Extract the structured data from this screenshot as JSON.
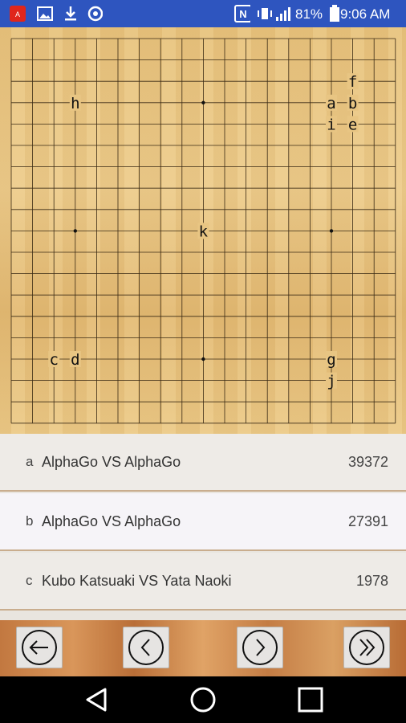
{
  "statusbar": {
    "left_icons": [
      "adobe-reader-icon",
      "image-icon",
      "download-icon",
      "sync-icon"
    ],
    "nfc_label": "N",
    "battery_percent": "81%",
    "time": "9:06 AM",
    "right_icons": [
      "nfc-icon",
      "vibrate-icon",
      "signal-icon",
      "battery-icon"
    ]
  },
  "board": {
    "size": 19,
    "labels": [
      {
        "text": "a"
      },
      {
        "text": "b"
      },
      {
        "text": "c"
      },
      {
        "text": "d"
      },
      {
        "text": "e"
      },
      {
        "text": "f"
      },
      {
        "text": "g"
      },
      {
        "text": "h"
      },
      {
        "text": "i"
      },
      {
        "text": "j"
      },
      {
        "text": "k"
      }
    ]
  },
  "games": [
    {
      "letter": "a",
      "title": "AlphaGo VS AlphaGo",
      "count": "39372"
    },
    {
      "letter": "b",
      "title": "AlphaGo VS AlphaGo",
      "count": "27391"
    },
    {
      "letter": "c",
      "title": "Kubo Katsuaki VS Yata Naoki",
      "count": "1978"
    }
  ],
  "controls": [
    {
      "name": "first-move-button",
      "icon": "arrow-left-icon"
    },
    {
      "name": "previous-move-button",
      "icon": "chevron-left-icon"
    },
    {
      "name": "next-move-button",
      "icon": "chevron-right-icon"
    },
    {
      "name": "last-move-button",
      "icon": "double-chevron-right-icon"
    }
  ],
  "navbar": [
    "back-icon",
    "home-icon",
    "recents-icon"
  ]
}
